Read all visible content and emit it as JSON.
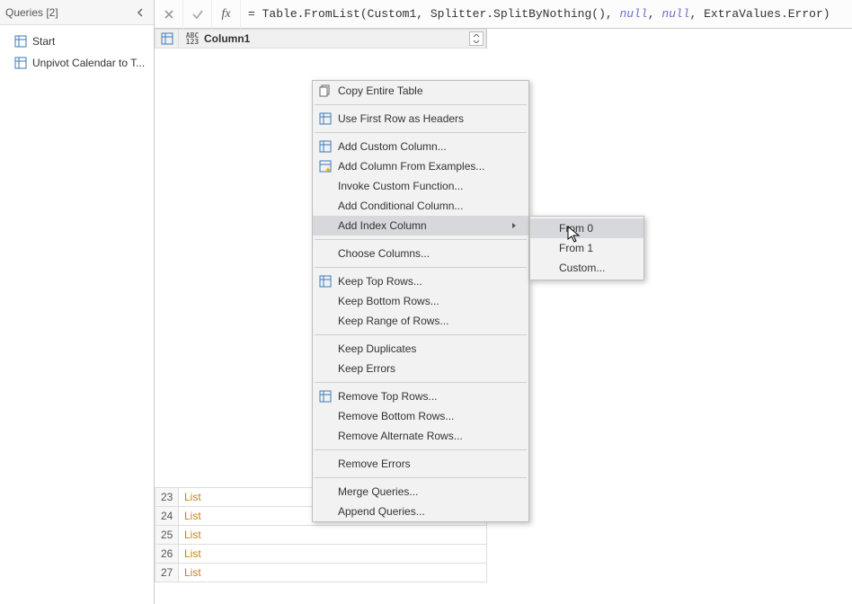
{
  "queries_panel": {
    "title": "Queries [2]",
    "items": [
      {
        "label": "Start"
      },
      {
        "label": "Unpivot Calendar to T..."
      }
    ]
  },
  "formula_bar": {
    "eq": "= ",
    "p1": "Table",
    "p1b": ".FromList(Custom1, Splitter.SplitByNothing(), ",
    "null1": "null",
    "comma1": ", ",
    "null2": "null",
    "comma2": ", ExtraValues.Error)"
  },
  "grid": {
    "column_type_label_top": "ABC",
    "column_type_label_bottom": "123",
    "column_name": "Column1",
    "visible_rows": [
      {
        "num": "23",
        "val": "List"
      },
      {
        "num": "24",
        "val": "List"
      },
      {
        "num": "25",
        "val": "List"
      },
      {
        "num": "26",
        "val": "List"
      },
      {
        "num": "27",
        "val": "List"
      }
    ]
  },
  "context_menu": {
    "items_block1": [
      {
        "label": "Copy Entire Table",
        "icon": "copy"
      }
    ],
    "items_block2": [
      {
        "label": "Use First Row as Headers",
        "icon": "table"
      }
    ],
    "items_block3": [
      {
        "label": "Add Custom Column...",
        "icon": "table"
      },
      {
        "label": "Add Column From Examples...",
        "icon": "table-star"
      },
      {
        "label": "Invoke Custom Function...",
        "icon": ""
      },
      {
        "label": "Add Conditional Column...",
        "icon": ""
      },
      {
        "label": "Add Index Column",
        "icon": "",
        "submenu": true,
        "highlight": true
      }
    ],
    "items_block4": [
      {
        "label": "Choose Columns...",
        "icon": ""
      }
    ],
    "items_block5": [
      {
        "label": "Keep Top Rows...",
        "icon": "table"
      },
      {
        "label": "Keep Bottom Rows...",
        "icon": ""
      },
      {
        "label": "Keep Range of Rows...",
        "icon": ""
      }
    ],
    "items_block6": [
      {
        "label": "Keep Duplicates",
        "icon": ""
      },
      {
        "label": "Keep Errors",
        "icon": ""
      }
    ],
    "items_block7": [
      {
        "label": "Remove Top Rows...",
        "icon": "table"
      },
      {
        "label": "Remove Bottom Rows...",
        "icon": ""
      },
      {
        "label": "Remove Alternate Rows...",
        "icon": ""
      }
    ],
    "items_block8": [
      {
        "label": "Remove Errors",
        "icon": ""
      }
    ],
    "items_block9": [
      {
        "label": "Merge Queries...",
        "icon": ""
      },
      {
        "label": "Append Queries...",
        "icon": ""
      }
    ]
  },
  "sub_menu": {
    "items": [
      {
        "label": "From 0",
        "highlight": true
      },
      {
        "label": "From 1"
      },
      {
        "label": "Custom..."
      }
    ]
  }
}
